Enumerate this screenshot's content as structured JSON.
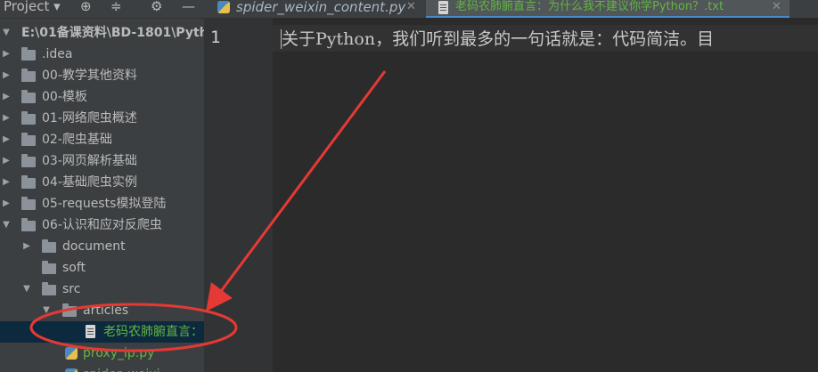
{
  "project_panel": {
    "title": "Project",
    "icons": [
      "dropdown-arrow-icon",
      "crosshair-icon",
      "collapse-icon",
      "gear-icon",
      "minimize-icon"
    ],
    "root": "E:\\01备课资料\\BD-1801\\Pyth",
    "items": [
      {
        "label": ".idea",
        "type": "folder"
      },
      {
        "label": "00-教学其他资料",
        "type": "folder"
      },
      {
        "label": "00-模板",
        "type": "folder"
      },
      {
        "label": "01-网络爬虫概述",
        "type": "folder"
      },
      {
        "label": "02-爬虫基础",
        "type": "folder"
      },
      {
        "label": "03-网页解析基础",
        "type": "folder"
      },
      {
        "label": "04-基础爬虫实例",
        "type": "folder"
      },
      {
        "label": "05-requests模拟登陆",
        "type": "folder"
      },
      {
        "label": "06-认识和应对反爬虫",
        "type": "folder"
      },
      {
        "label": "document",
        "type": "folder"
      },
      {
        "label": "soft",
        "type": "folder"
      },
      {
        "label": "src",
        "type": "folder"
      },
      {
        "label": "articles",
        "type": "folder"
      },
      {
        "label": "老码农肺腑直言：",
        "type": "txt"
      },
      {
        "label": "proxy_ip.py",
        "type": "py"
      },
      {
        "label": "spider_weixi",
        "type": "py"
      }
    ]
  },
  "tabs": [
    {
      "label": "spider_weixin_content.py",
      "icon": "python-file-icon"
    },
    {
      "label": "老码农肺腑直言：为什么我不建议你学Python？.txt",
      "icon": "text-file-icon"
    }
  ],
  "editor": {
    "line_number": "1",
    "text": "关于Python，我们听到最多的一句话就是：代码简洁。目"
  },
  "colors": {
    "accent": "#4a88c7",
    "annotation": "#e53935",
    "selected_file": "#62b543"
  }
}
